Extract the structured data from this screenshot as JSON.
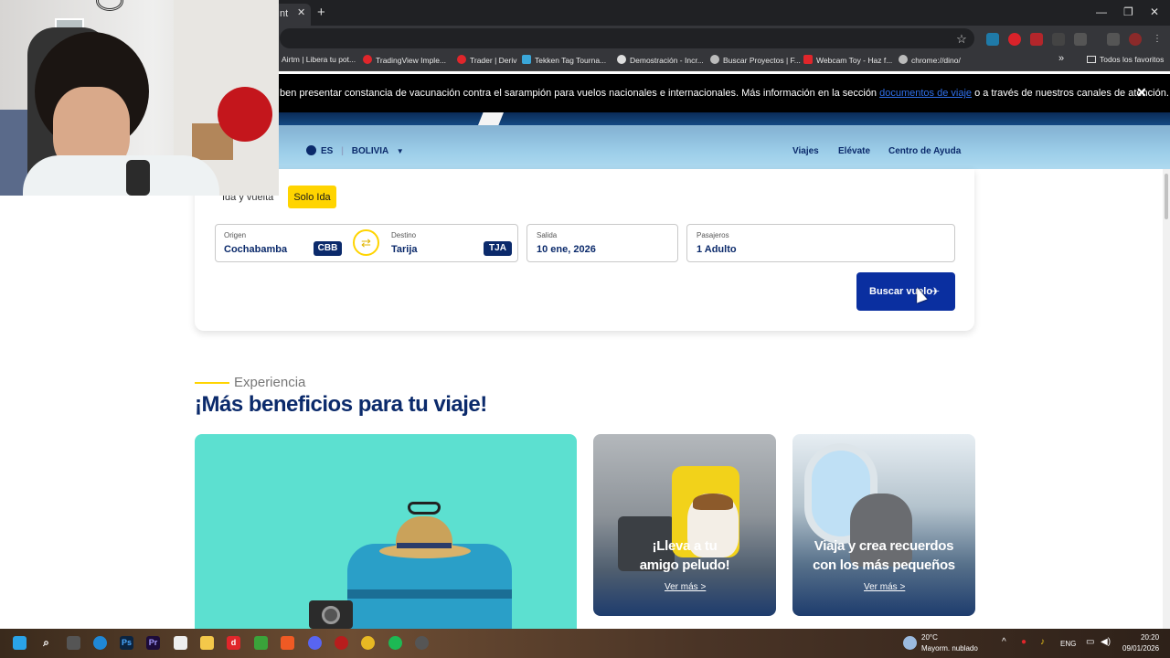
{
  "browser": {
    "tab_title": "nt",
    "bookmarks": [
      {
        "label": "Airtm | Libera tu pot...",
        "color": "#2e7dd7"
      },
      {
        "label": "TradingView Imple...",
        "color": "#e0262b"
      },
      {
        "label": "Trader | Deriv",
        "color": "#e0262b"
      },
      {
        "label": "Tekken Tag Tourna...",
        "color": "#3aa6d8"
      },
      {
        "label": "Demostración - Incr...",
        "color": "#dddddd"
      },
      {
        "label": "Buscar Proyectos | F...",
        "color": "#bbbbbb"
      },
      {
        "label": "Webcam Toy - Haz f...",
        "color": "#e0262b"
      },
      {
        "label": "chrome://dino/",
        "color": "#bbbbbb"
      }
    ],
    "bookmarks_more": "»",
    "all_bookmarks": "Todos los favoritos"
  },
  "notice": {
    "text_before": "ben presentar constancia de vacunación contra el sarampión para vuelos nacionales e internacionales. Más información en la sección ",
    "link_text": "documentos de viaje",
    "text_after": " o a través de nuestros canales de atención."
  },
  "header": {
    "language": "ES",
    "separator": "|",
    "country": "BOLIVIA",
    "nav": [
      "Viajes",
      "Elévate",
      "Centro de Ayuda"
    ]
  },
  "booking": {
    "trip_types": [
      "Ida y vuelta",
      "Solo Ida"
    ],
    "selected_trip": "Solo Ida",
    "origin": {
      "label": "Origen",
      "city": "Cochabamba",
      "code": "CBB"
    },
    "destination": {
      "label": "Destino",
      "city": "Tarija",
      "code": "TJA"
    },
    "departure": {
      "label": "Salida",
      "value": "10 ene, 2026"
    },
    "passengers": {
      "label": "Pasajeros",
      "value": "1 Adulto"
    },
    "search_label": "Buscar vuelo"
  },
  "experience": {
    "kicker": "Experiencia",
    "title": "¡Más beneficios para tu viaje!",
    "cards": [
      {
        "line1": "¡Lleva a tu",
        "line2": "amigo peludo!",
        "link": "Ver más >"
      },
      {
        "line1": "Viaja y crea recuerdos",
        "line2": "con los más pequeños",
        "link": "Ver más >"
      }
    ]
  },
  "taskbar": {
    "weather_temp": "20°C",
    "weather_desc": "Mayorm. nublado",
    "lang": "ENG",
    "time": "20:20",
    "date": "09/01/2026"
  },
  "colors": {
    "brand_navy": "#0b2a6b",
    "brand_yellow": "#ffd400",
    "button_blue": "#0a2fa0"
  }
}
